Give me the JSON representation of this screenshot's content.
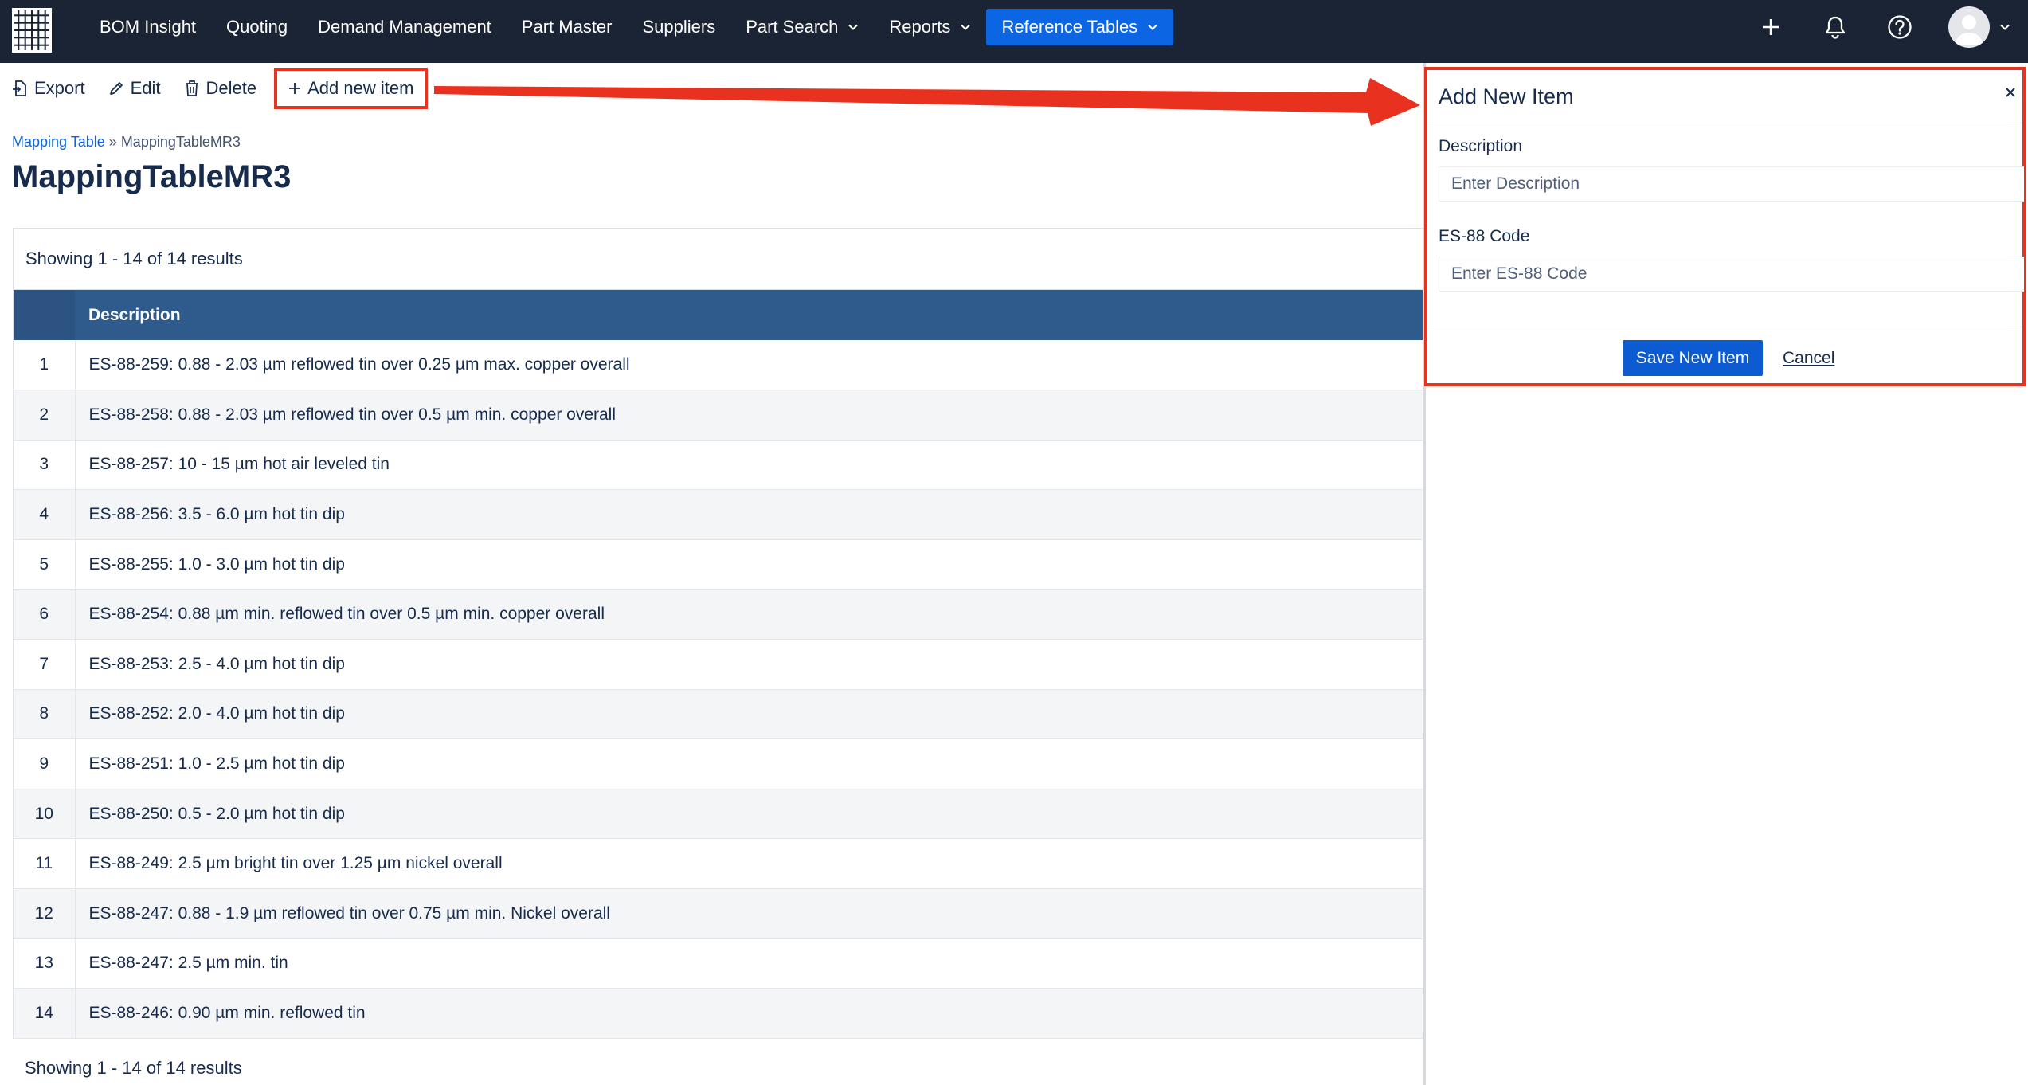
{
  "nav": {
    "items": [
      {
        "label": "BOM Insight",
        "dropdown": false,
        "active": false
      },
      {
        "label": "Quoting",
        "dropdown": false,
        "active": false
      },
      {
        "label": "Demand Management",
        "dropdown": false,
        "active": false
      },
      {
        "label": "Part Master",
        "dropdown": false,
        "active": false
      },
      {
        "label": "Suppliers",
        "dropdown": false,
        "active": false
      },
      {
        "label": "Part Search",
        "dropdown": true,
        "active": false
      },
      {
        "label": "Reports",
        "dropdown": true,
        "active": false
      },
      {
        "label": "Reference Tables",
        "dropdown": true,
        "active": true
      }
    ],
    "icons": [
      "app-grid-icon",
      "plus-icon",
      "bell-icon",
      "help-icon",
      "avatar"
    ]
  },
  "toolbar": {
    "export_label": "Export",
    "edit_label": "Edit",
    "delete_label": "Delete",
    "add_label": "Add new item"
  },
  "breadcrumb": {
    "link": "Mapping Table",
    "separator": "»",
    "current": "MappingTableMR3"
  },
  "page_title": "MappingTableMR3",
  "table": {
    "results_text": "Showing 1 - 14 of 14 results",
    "header_description": "Description",
    "rows": [
      {
        "num": "1",
        "description": "ES-88-259: 0.88 - 2.03 µm reflowed tin over 0.25 µm max. copper overall"
      },
      {
        "num": "2",
        "description": "ES-88-258: 0.88 - 2.03 µm reflowed tin over 0.5 µm min. copper overall"
      },
      {
        "num": "3",
        "description": "ES-88-257: 10 - 15 µm hot air leveled tin"
      },
      {
        "num": "4",
        "description": "ES-88-256: 3.5 - 6.0 µm hot tin dip"
      },
      {
        "num": "5",
        "description": "ES-88-255: 1.0 - 3.0 µm hot tin dip"
      },
      {
        "num": "6",
        "description": "ES-88-254: 0.88 µm min. reflowed tin over 0.5 µm min. copper overall"
      },
      {
        "num": "7",
        "description": "ES-88-253: 2.5 - 4.0 µm hot tin dip"
      },
      {
        "num": "8",
        "description": "ES-88-252: 2.0 - 4.0 µm hot tin dip"
      },
      {
        "num": "9",
        "description": "ES-88-251: 1.0 - 2.5 µm hot tin dip"
      },
      {
        "num": "10",
        "description": "ES-88-250: 0.5 - 2.0 µm hot tin dip"
      },
      {
        "num": "11",
        "description": "ES-88-249: 2.5 µm bright tin over 1.25 µm nickel overall"
      },
      {
        "num": "12",
        "description": "ES-88-247: 0.88 - 1.9 µm reflowed tin over 0.75 µm min. Nickel overall"
      },
      {
        "num": "13",
        "description": "ES-88-247: 2.5 µm min. tin"
      },
      {
        "num": "14",
        "description": "ES-88-246: 0.90 µm min. reflowed tin"
      }
    ],
    "results_text_bottom": "Showing 1 - 14 of 14 results"
  },
  "panel": {
    "title": "Add New Item",
    "close_symbol": "×",
    "description_label": "Description",
    "description_placeholder": "Enter Description",
    "description_value": "",
    "code_label": "ES-88 Code",
    "code_placeholder": "Enter ES-88 Code",
    "code_value": "",
    "save_label": "Save New Item",
    "cancel_label": "Cancel"
  },
  "colors": {
    "nav_bg": "#1b2434",
    "accent": "#0c66e4",
    "table_header": "#2f5a8c",
    "annotation_red": "#e8321f"
  }
}
